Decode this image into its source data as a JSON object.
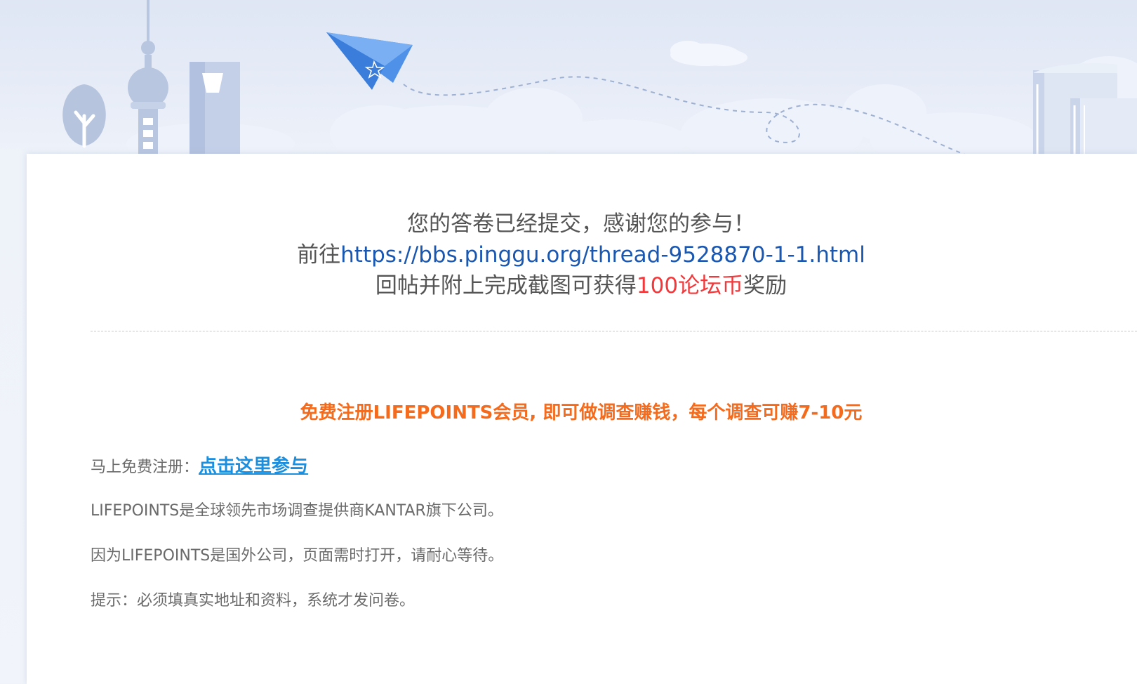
{
  "thanks": {
    "line1": "您的答卷已经提交，感谢您的参与！",
    "line2_prefix": "前往",
    "line2_link": "https://bbs.pinggu.org/thread-9528870-1-1.html",
    "line3_prefix": "回帖并附上完成截图可获得",
    "line3_reward": "100论坛币",
    "line3_suffix": "奖励"
  },
  "promo": {
    "text": "免费注册LIFEPOINTS会员, 即可做调查赚钱，每个调查可赚7-10元"
  },
  "register": {
    "label": "马上免费注册：",
    "link": "点击这里参与"
  },
  "info": {
    "line1": "LIFEPOINTS是全球领先市场调查提供商KANTAR旗下公司。",
    "line2": "因为LIFEPOINTS是国外公司，页面需时打开，请耐心等待。",
    "line3": "提示：必须填真实地址和资料，系统才发问卷。"
  },
  "colors": {
    "link_blue": "#1a57b0",
    "reward_red": "#f2383a",
    "promo_orange": "#f46b1e",
    "register_link_blue": "#1a8fe0",
    "banner_bg": "#dfe6f4"
  },
  "banner_icons": [
    "tree-icon",
    "tv-tower-icon",
    "skyscraper-icon",
    "paper-plane-icon",
    "cloud-icon",
    "books-icon"
  ]
}
